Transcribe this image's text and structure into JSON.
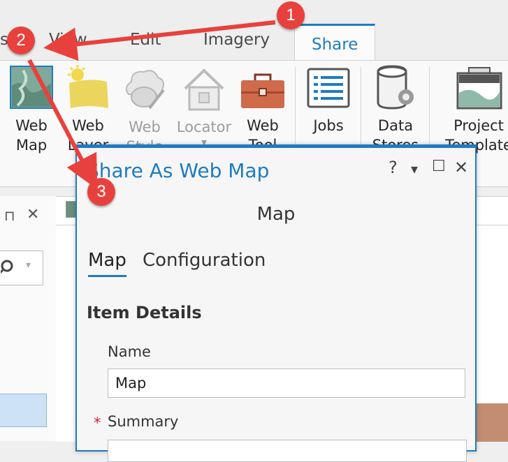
{
  "ribbon_tabs": [
    {
      "label": "s",
      "active": false
    },
    {
      "label": "View",
      "active": false
    },
    {
      "label": "Edit",
      "active": false
    },
    {
      "label": "Imagery",
      "active": false
    },
    {
      "label": "Share",
      "active": true
    }
  ],
  "ribbon_buttons": [
    {
      "line1": "Web",
      "line2": "Map",
      "icon": "web-map-icon",
      "disabled": false
    },
    {
      "line1": "Web",
      "line2": "Layer",
      "icon": "web-layer-icon",
      "disabled": false
    },
    {
      "line1": "Web",
      "line2": "Style",
      "icon": "web-style-icon",
      "disabled": true
    },
    {
      "line1": "Locator",
      "line2": "",
      "icon": "locator-icon",
      "disabled": true
    },
    {
      "line1": "Web",
      "line2": "Tool",
      "icon": "web-tool-icon",
      "disabled": false
    },
    {
      "line1": "Jobs",
      "line2": "",
      "icon": "jobs-icon",
      "disabled": false
    },
    {
      "line1": "Data",
      "line2": "Stores",
      "icon": "data-stores-icon",
      "disabled": false
    },
    {
      "line1": "Project",
      "line2": "Template",
      "icon": "project-template-icon",
      "disabled": false
    }
  ],
  "dialog": {
    "title": "Share As Web Map",
    "help": "?",
    "menu": "▾",
    "maximize": "☐",
    "close": "✕",
    "subtitle": "Map",
    "tabs": [
      {
        "label": "Map",
        "active": true
      },
      {
        "label": "Configuration",
        "active": false
      }
    ],
    "section_title": "Item Details",
    "name_label": "Name",
    "name_value": "Map",
    "required_mark": "*",
    "summary_label": "Summary"
  },
  "left_pane": {
    "pin": "⊓",
    "close": "✕"
  },
  "callouts": [
    "1",
    "2",
    "3"
  ],
  "colors": {
    "accent": "#1f7bc1",
    "callout": "#e8413d",
    "arrow": "#e8413d"
  }
}
